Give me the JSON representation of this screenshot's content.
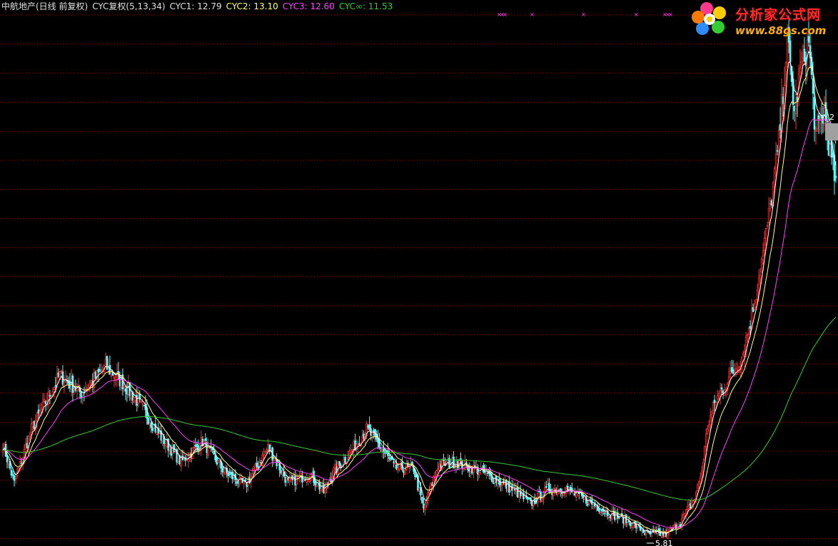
{
  "legend": {
    "stock": "中航地产(日线 前复权)",
    "indicator": "CYC复权(5,13,34)",
    "cyc1": "CYC1: 12.79",
    "cyc2": "CYC2: 13.10",
    "cyc3": "CYC3: 12.60",
    "cycinf": "CYC∞: 11.53"
  },
  "logo": {
    "name": "分析家公式网",
    "url": "www.88gs.com"
  },
  "colors": {
    "background": "#000000",
    "grid": "#8b0000",
    "up": "#ff3030",
    "down": "#54ffff",
    "cyc1": "#ffffff",
    "cyc2": "#ffff80",
    "cyc3": "#ff40ff",
    "cycinf": "#33cc33",
    "legend_white": "#e0e0e0",
    "legend_yellow": "#ffff66",
    "legend_magenta": "#ff40ff",
    "legend_green": "#33cc33"
  },
  "chart_data": {
    "type": "candlestick",
    "y_min_label": "5.81",
    "y_max_partial_label": "2",
    "grid": true,
    "anchors": [
      [
        0,
        8.9
      ],
      [
        8,
        7.6
      ],
      [
        20,
        9.4
      ],
      [
        40,
        11.2
      ],
      [
        55,
        10.6
      ],
      [
        72,
        11.5
      ],
      [
        85,
        10.9
      ],
      [
        95,
        10.3
      ],
      [
        110,
        9.2
      ],
      [
        125,
        8.3
      ],
      [
        140,
        9.0
      ],
      [
        155,
        8.0
      ],
      [
        170,
        7.5
      ],
      [
        186,
        8.8
      ],
      [
        200,
        7.6
      ],
      [
        215,
        7.9
      ],
      [
        225,
        7.3
      ],
      [
        232,
        8.0
      ],
      [
        240,
        8.4
      ],
      [
        255,
        9.4
      ],
      [
        262,
        9.0
      ],
      [
        275,
        8.1
      ],
      [
        288,
        8.1
      ],
      [
        295,
        6.7
      ],
      [
        305,
        8.2
      ],
      [
        318,
        8.3
      ],
      [
        335,
        8.0
      ],
      [
        350,
        7.6
      ],
      [
        360,
        7.3
      ],
      [
        370,
        6.9
      ],
      [
        382,
        7.4
      ],
      [
        395,
        7.4
      ],
      [
        410,
        7.0
      ],
      [
        425,
        6.6
      ],
      [
        440,
        6.3
      ],
      [
        452,
        5.9
      ],
      [
        465,
        5.9
      ],
      [
        475,
        6.3
      ],
      [
        485,
        7.1
      ],
      [
        490,
        8.0
      ],
      [
        494,
        9.5
      ],
      [
        500,
        10.4
      ],
      [
        508,
        11.0
      ],
      [
        518,
        11.8
      ],
      [
        525,
        13.2
      ],
      [
        532,
        15.0
      ],
      [
        538,
        16.8
      ],
      [
        544,
        19.0
      ],
      [
        550,
        22.4
      ],
      [
        555,
        20.0
      ],
      [
        560,
        21.6
      ],
      [
        565,
        22.3
      ],
      [
        570,
        19.2
      ],
      [
        576,
        20.0
      ],
      [
        580,
        18.6
      ],
      [
        584,
        17.6
      ]
    ],
    "series": [
      {
        "name": "CYC1",
        "period": 5
      },
      {
        "name": "CYC2",
        "period": 13
      },
      {
        "name": "CYC3",
        "period": 34
      },
      {
        "name": "CYC∞",
        "period": 200
      }
    ]
  }
}
